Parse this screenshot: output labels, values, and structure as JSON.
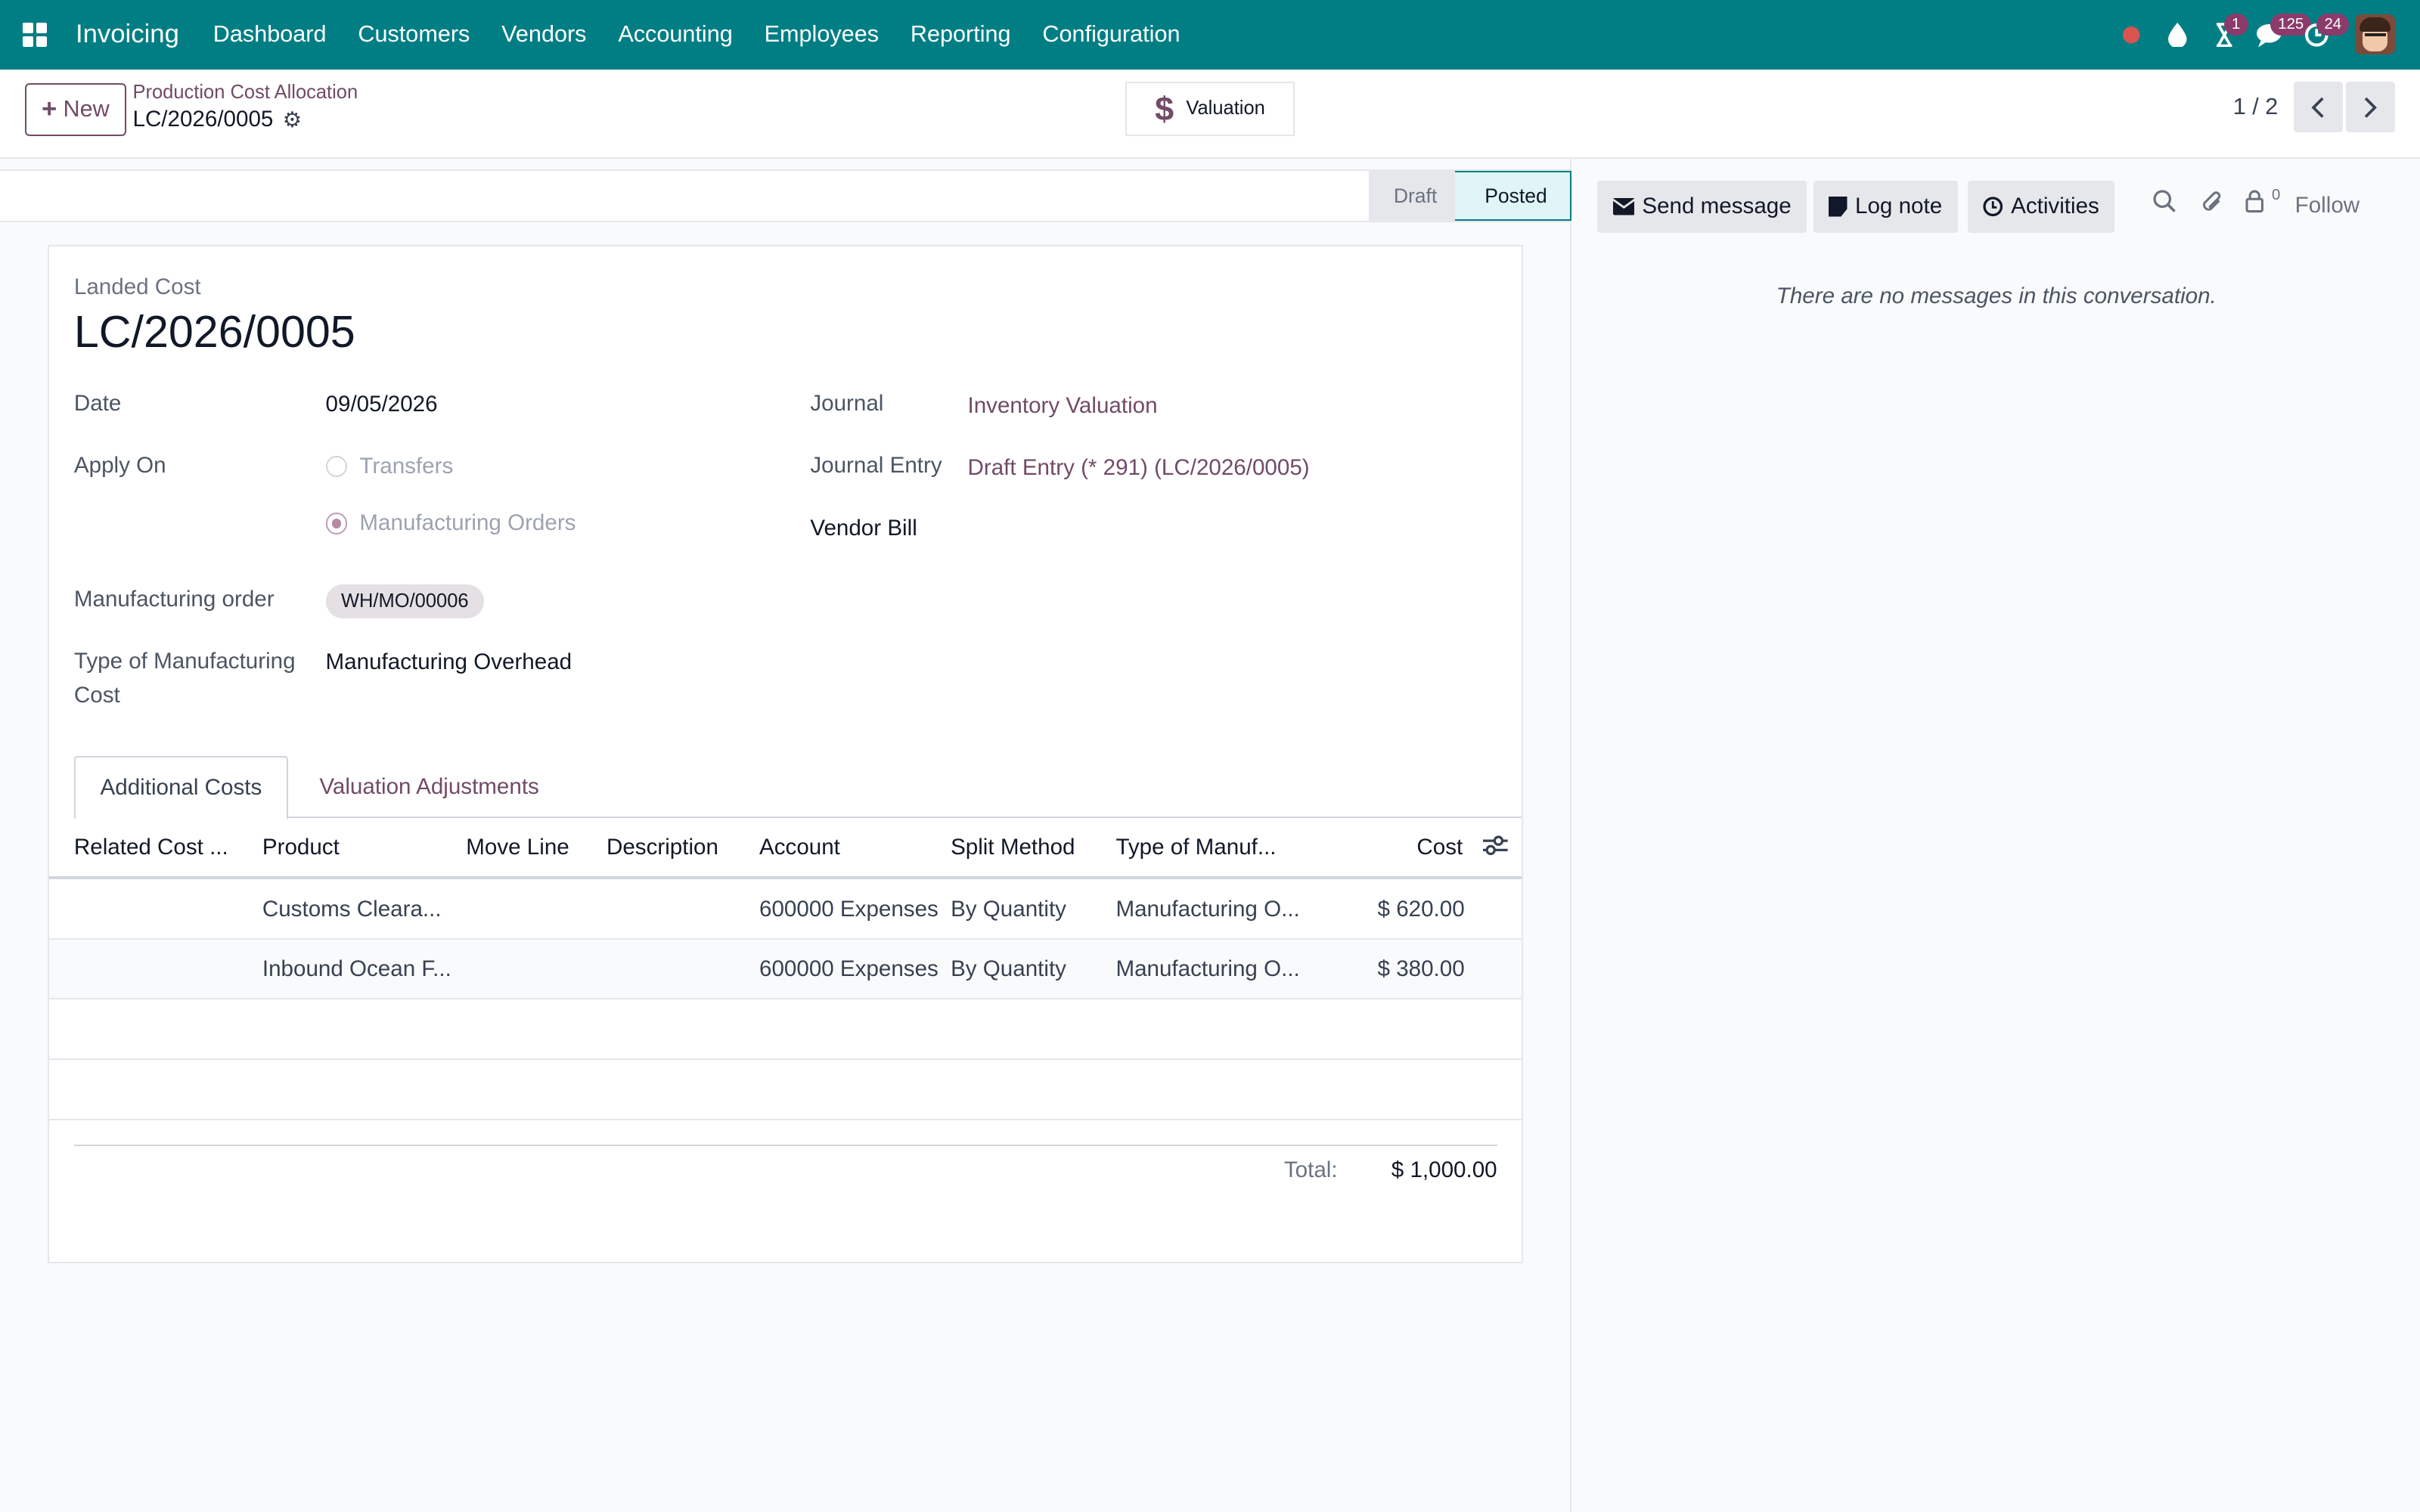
{
  "topnav": {
    "brand": "Invoicing",
    "menu": [
      "Dashboard",
      "Customers",
      "Vendors",
      "Accounting",
      "Employees",
      "Reporting",
      "Configuration"
    ],
    "activity_badge": "1",
    "messages_badge": "125",
    "updates_badge": "24",
    "accent": "#017e84"
  },
  "control": {
    "new_label": "New",
    "breadcrumb_parent": "Production Cost Allocation",
    "breadcrumb_current": "LC/2026/0005",
    "smart_button_label": "Valuation",
    "pager_value": "1 / 2"
  },
  "status": {
    "stages": [
      "Draft",
      "Posted"
    ],
    "current": "Posted"
  },
  "form": {
    "subtitle": "Landed Cost",
    "title": "LC/2026/0005",
    "date_label": "Date",
    "date_value": "09/05/2026",
    "apply_on_label": "Apply On",
    "apply_options": [
      "Transfers",
      "Manufacturing Orders"
    ],
    "apply_selected": "Manufacturing Orders",
    "mo_label": "Manufacturing order",
    "mo_tag": "WH/MO/00006",
    "cost_type_label_1": "Type of Manufacturing",
    "cost_type_label_2": "Cost",
    "cost_type_value": "Manufacturing Overhead",
    "journal_label": "Journal",
    "journal_value": "Inventory Valuation",
    "journal_entry_label": "Journal Entry",
    "journal_entry_value": "Draft Entry (* 291) (LC/2026/0005)",
    "vendor_bill_label": "Vendor Bill"
  },
  "tabs": [
    "Additional Costs",
    "Valuation Adjustments"
  ],
  "table": {
    "headers": [
      "Related Cost ...",
      "Product",
      "Move Line",
      "Description",
      "Account",
      "Split Method",
      "Type of Manuf...",
      "Cost"
    ],
    "rows": [
      {
        "related": "",
        "product": "Customs Cleara...",
        "move_line": "",
        "description": "",
        "account": "600000 Expenses",
        "split": "By Quantity",
        "type": "Manufacturing O...",
        "cost": "$ 620.00"
      },
      {
        "related": "",
        "product": "Inbound Ocean F...",
        "move_line": "",
        "description": "",
        "account": "600000 Expenses",
        "split": "By Quantity",
        "type": "Manufacturing O...",
        "cost": "$ 380.00"
      }
    ],
    "total_label": "Total:",
    "total_value": "$ 1,000.00"
  },
  "chatter": {
    "send_message": "Send message",
    "log_note": "Log note",
    "activities": "Activities",
    "follower_count": "0",
    "follow": "Follow",
    "empty": "There are no messages in this conversation."
  }
}
